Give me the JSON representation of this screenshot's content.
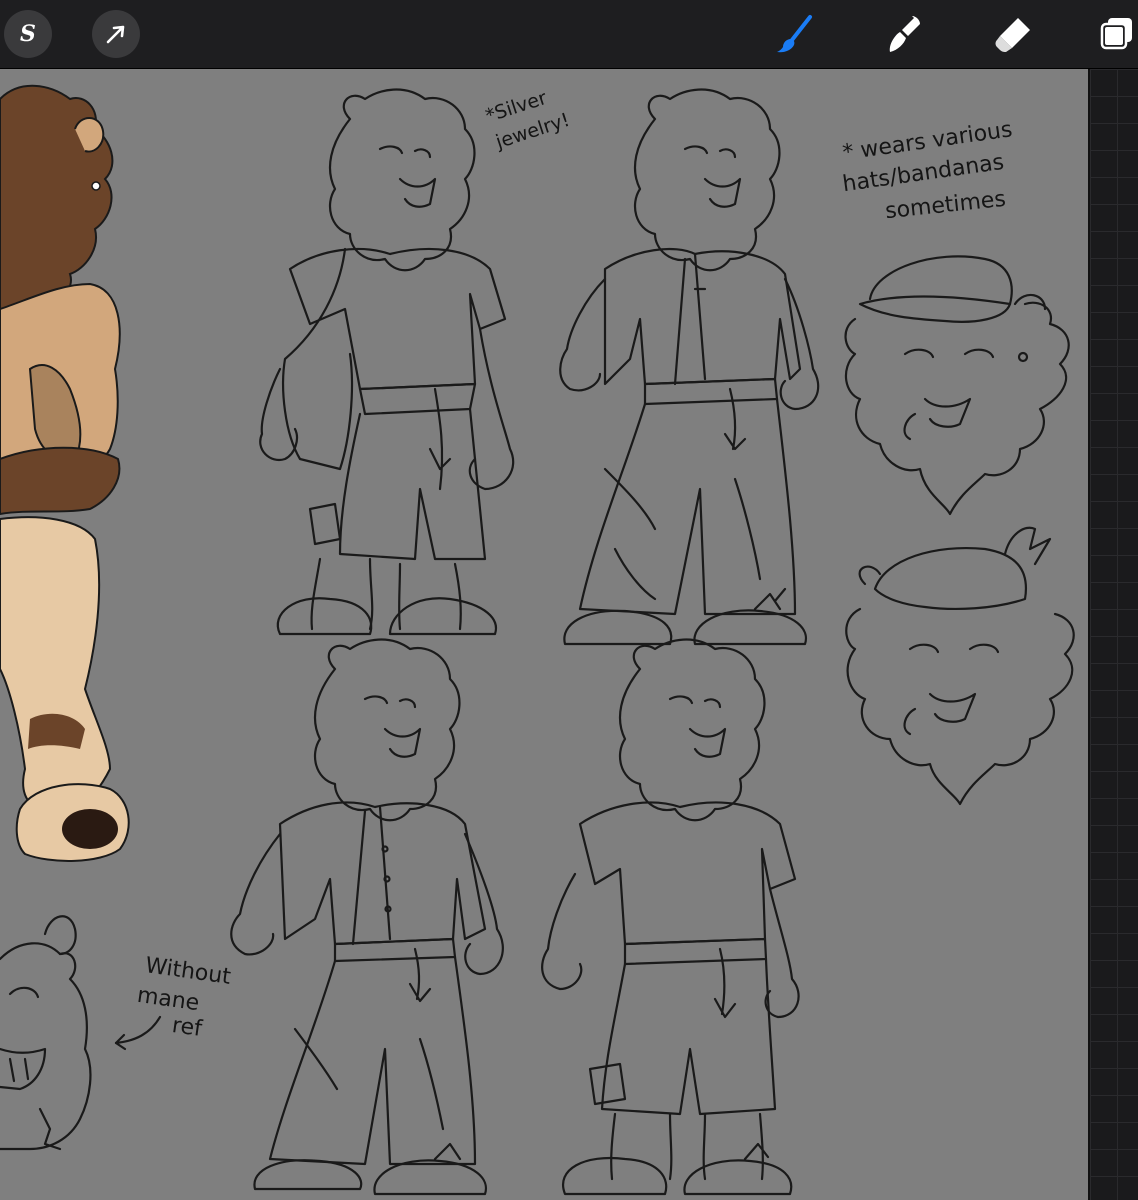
{
  "toolbar": {
    "left_tools": [
      {
        "name": "adjustments",
        "icon": "adjustments-s-icon",
        "glyph": "S"
      },
      {
        "name": "selection",
        "icon": "selection-arrow-icon"
      }
    ],
    "right_tools": [
      {
        "name": "brush",
        "icon": "brush-icon",
        "active": true,
        "color": "#1a7cf5"
      },
      {
        "name": "smudge",
        "icon": "smudge-icon",
        "active": false
      },
      {
        "name": "eraser",
        "icon": "eraser-icon",
        "active": false
      },
      {
        "name": "layers",
        "icon": "layers-icon",
        "active": false
      }
    ]
  },
  "canvas": {
    "background": "#7f7f7f",
    "notes": {
      "silver_line1": "*Silver",
      "silver_line2": "jewelry!",
      "hats_line1": "* wears various",
      "hats_line2": "hats/bandanas",
      "hats_line3": "sometimes",
      "mane_line1": "Without",
      "mane_line2": "mane",
      "mane_line3": "ref"
    }
  },
  "colors": {
    "ink": "#1a1a1a",
    "fur_brown": "#6b4429",
    "fur_tan": "#d2a77c",
    "fur_light": "#e7c9a4",
    "accent": "#1a7cf5"
  }
}
